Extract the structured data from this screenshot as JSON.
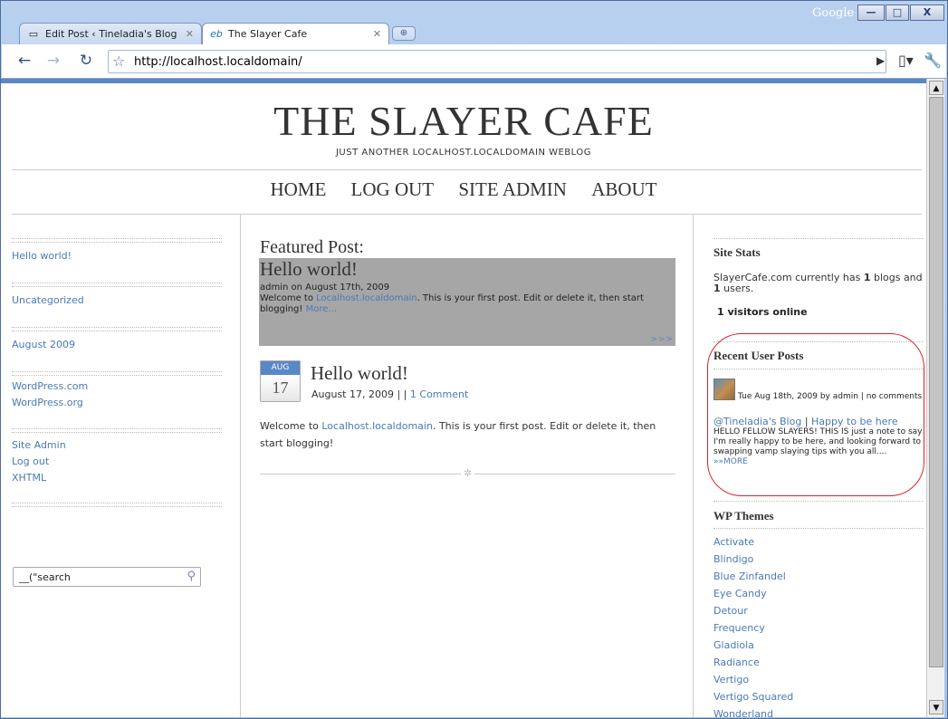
{
  "browser": {
    "tabs": [
      {
        "title": "Edit Post ‹ Tineladia's Blog ...",
        "icon": "page-icon"
      },
      {
        "title": "The Slayer Cafe",
        "icon": "edublogs-icon"
      }
    ],
    "brand": "Google",
    "url": "http://localhost.localdomain/"
  },
  "site": {
    "title": "THE SLAYER CAFE",
    "tagline": "JUST ANOTHER LOCALHOST.LOCALDOMAIN WEBLOG",
    "nav": [
      "HOME",
      "LOG OUT",
      "SITE ADMIN",
      "ABOUT"
    ]
  },
  "leftbar": {
    "recent_post": "Hello world!",
    "category": "Uncategorized",
    "archive": "August 2009",
    "blogroll": [
      "WordPress.com",
      "WordPress.org"
    ],
    "meta": [
      "Site Admin",
      "Log out",
      "XHTML"
    ],
    "search_value": "__(\"search"
  },
  "featured": {
    "label": "Featured Post:",
    "title": "Hello world!",
    "meta": "admin on August 17th, 2009",
    "excerpt_pre": "Welcome to ",
    "excerpt_link": "Localhost.localdomain",
    "excerpt_post": ". This is your first post. Edit or delete it, then start blogging! ",
    "more": "More...",
    "arrows": ">>>"
  },
  "post": {
    "month": "AUG",
    "day": "17",
    "title": "Hello world!",
    "meta_prefix": "August 17, 2009 | | ",
    "comments": "1 Comment",
    "body_pre": "Welcome to ",
    "body_link": "Localhost.localdomain",
    "body_post": ". This is your first post. Edit or delete it, then start blogging!"
  },
  "rightbar": {
    "stats_head": "Site Stats",
    "stats_pre": "SlayerCafe.com currently has ",
    "blogs_count": "1",
    "stats_mid": " blogs and ",
    "users_count": "1",
    "stats_post": " users.",
    "visitors": "1 visitors online",
    "recent_head": "Recent User Posts",
    "recent_meta": "Tue Aug 18th, 2009 by admin | no comments",
    "recent_blog": "@Tineladia's Blog",
    "recent_sep": " | ",
    "recent_title": "Happy to be here",
    "recent_body": "HELLO FELLOW SLAYERS! THIS IS just a note to say I'm really happy to be here, and looking forward to swapping vamp slaying tips with you all.... ",
    "recent_more": "»»MORE",
    "themes_head": "WP Themes",
    "themes": [
      "Activate",
      "Blindigo",
      "Blue Zinfandel",
      "Eye Candy",
      "Detour",
      "Frequency",
      "Gladiola",
      "Radiance",
      "Vertigo",
      "Vertigo Squared",
      "Wonderland"
    ]
  }
}
